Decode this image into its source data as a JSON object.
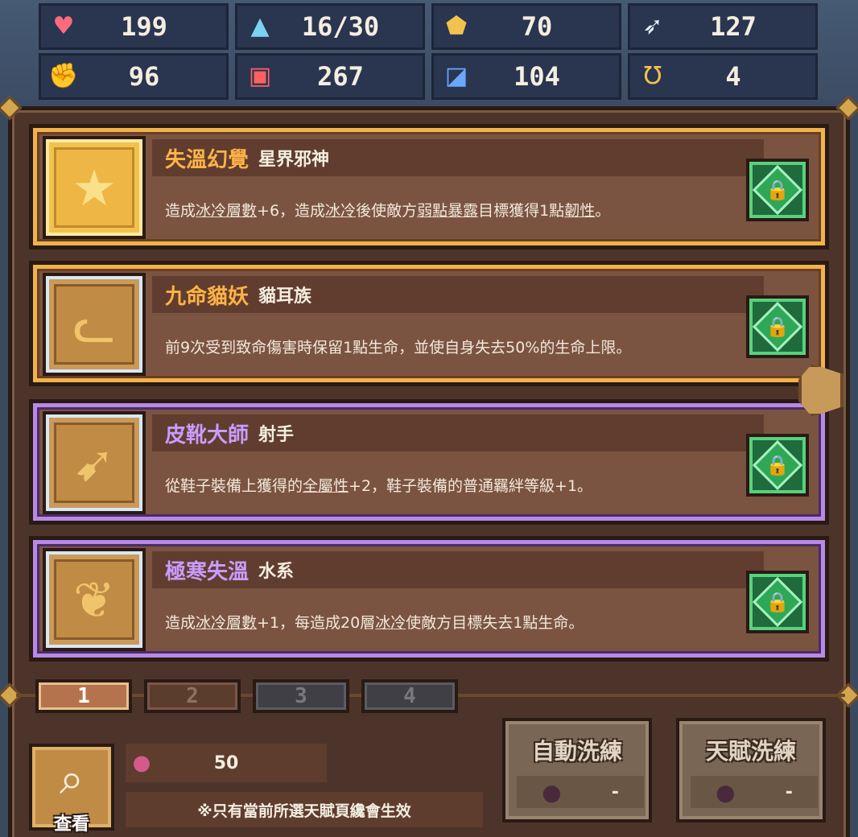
{
  "stats": [
    {
      "icon": "heart-icon",
      "glyph": "♥",
      "color": "#ff6b7a",
      "value": "199"
    },
    {
      "icon": "mana-drop-icon",
      "glyph": "▲",
      "color": "#7ad3f0",
      "value": "16/30"
    },
    {
      "icon": "shield-icon",
      "glyph": "⬟",
      "color": "#f2c24f",
      "value": "70"
    },
    {
      "icon": "wing-icon",
      "glyph": "➶",
      "color": "#e6eef8",
      "value": "127"
    },
    {
      "icon": "fist-icon",
      "glyph": "✊",
      "color": "#f4a0a0",
      "value": "96"
    },
    {
      "icon": "spellbook-icon",
      "glyph": "▣",
      "color": "#ff6060",
      "value": "267"
    },
    {
      "icon": "boot-icon",
      "glyph": "◪",
      "color": "#6aa8ff",
      "value": "104"
    },
    {
      "icon": "horseshoe-icon",
      "glyph": "Ʊ",
      "color": "#f2c24f",
      "value": "4"
    }
  ],
  "talents": [
    {
      "name": "失溫幻覺",
      "tag": "星界邪神",
      "rarity": "gold",
      "icon": "star-icon",
      "glyph": "★",
      "desc": [
        {
          "t": "造成"
        },
        {
          "t": "冰冷層數",
          "u": true
        },
        {
          "t": "+6，造成"
        },
        {
          "t": "冰冷",
          "u": true
        },
        {
          "t": "後使敵方"
        },
        {
          "t": "弱點暴露",
          "u": true
        },
        {
          "t": "目標獲得1點"
        },
        {
          "t": "韌性",
          "u": true
        },
        {
          "t": "。"
        }
      ]
    },
    {
      "name": "九命貓妖",
      "tag": "貓耳族",
      "rarity": "gold",
      "icon": "cat-icon",
      "glyph": "ᓚ",
      "desc": [
        {
          "t": "前9次受到致命傷害時保留1點生命，並使自身失去50%的生命上限。"
        }
      ]
    },
    {
      "name": "皮靴大師",
      "tag": "射手",
      "rarity": "purple",
      "icon": "bow-icon",
      "glyph": "➹",
      "desc": [
        {
          "t": "從鞋子裝備上獲得的"
        },
        {
          "t": "全屬性",
          "u": true
        },
        {
          "t": "+2，鞋子裝備的普通羈絆等級+1。"
        }
      ]
    },
    {
      "name": "極寒失溫",
      "tag": "水系",
      "rarity": "purple",
      "icon": "water-drop-icon",
      "glyph": "❦",
      "desc": [
        {
          "t": "造成"
        },
        {
          "t": "冰冷層數",
          "u": true
        },
        {
          "t": "+1，每造成20層"
        },
        {
          "t": "冰冷",
          "u": true
        },
        {
          "t": "使敵方目標失去1點生命。"
        }
      ]
    }
  ],
  "lock_glyph": "🔒",
  "tabs": [
    "1",
    "2",
    "3",
    "4"
  ],
  "active_tab": "1",
  "search": {
    "label": "查看",
    "glyph": "⌕"
  },
  "currency": {
    "glyph": "●",
    "amount": "50"
  },
  "notice": "※只有當前所選天賦頁纔會生效",
  "buttons": {
    "auto_reroll": {
      "label": "自動洗練",
      "cost": "-"
    },
    "talent_reroll": {
      "label": "天賦洗練",
      "cost": "-"
    }
  }
}
